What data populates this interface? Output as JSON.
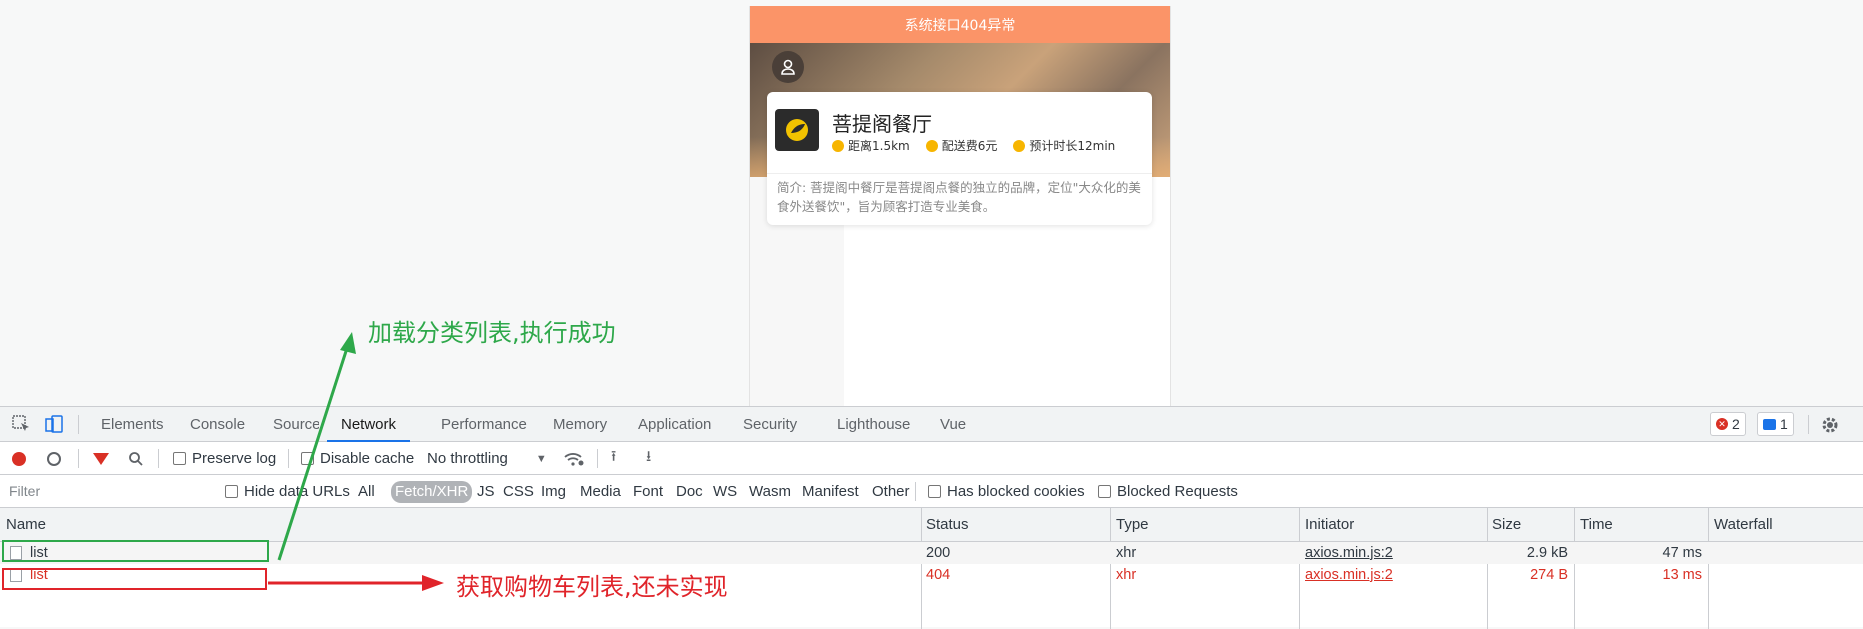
{
  "app": {
    "banner": "系统接口404异常",
    "shop": {
      "name": "菩提阁餐厅",
      "distance": "距离1.5km",
      "delivery_fee": "配送费6元",
      "eta": "预计时长12min",
      "intro": "简介: 菩提阁中餐厅是菩提阁点餐的独立的品牌，定位\"大众化的美食外送餐饮\"，旨为顾客打造专业美食。"
    }
  },
  "devtools": {
    "tabs": [
      "Elements",
      "Console",
      "Sources",
      "Network",
      "Performance",
      "Memory",
      "Application",
      "Security",
      "Lighthouse",
      "Vue"
    ],
    "active_tab": "Network",
    "errors_count": "2",
    "messages_count": "1",
    "toolbar": {
      "preserve_log": "Preserve log",
      "disable_cache": "Disable cache",
      "throttling": "No throttling"
    },
    "filter": {
      "placeholder": "Filter",
      "hide_data_urls": "Hide data URLs",
      "types": [
        "All",
        "Fetch/XHR",
        "JS",
        "CSS",
        "Img",
        "Media",
        "Font",
        "Doc",
        "WS",
        "Wasm",
        "Manifest",
        "Other"
      ],
      "active_type": "Fetch/XHR",
      "has_blocked_cookies": "Has blocked cookies",
      "blocked_requests": "Blocked Requests"
    },
    "columns": [
      "Name",
      "Status",
      "Type",
      "Initiator",
      "Size",
      "Time",
      "Waterfall"
    ],
    "rows": [
      {
        "name": "list",
        "status": "200",
        "type": "xhr",
        "initiator": "axios.min.js:2",
        "size": "2.9 kB",
        "time": "47 ms"
      },
      {
        "name": "list",
        "status": "404",
        "type": "xhr",
        "initiator": "axios.min.js:2",
        "size": "274 B",
        "time": "13 ms"
      }
    ]
  },
  "annotations": {
    "success": "加载分类列表,执行成功",
    "failure": "获取购物车列表,还未实现",
    "success_color": "#2ea84a",
    "failure_color": "#e0242a"
  },
  "colors": {
    "banner_bg": "#fb9468",
    "devtools_accent": "#1a73e8",
    "error_red": "#d93025"
  }
}
